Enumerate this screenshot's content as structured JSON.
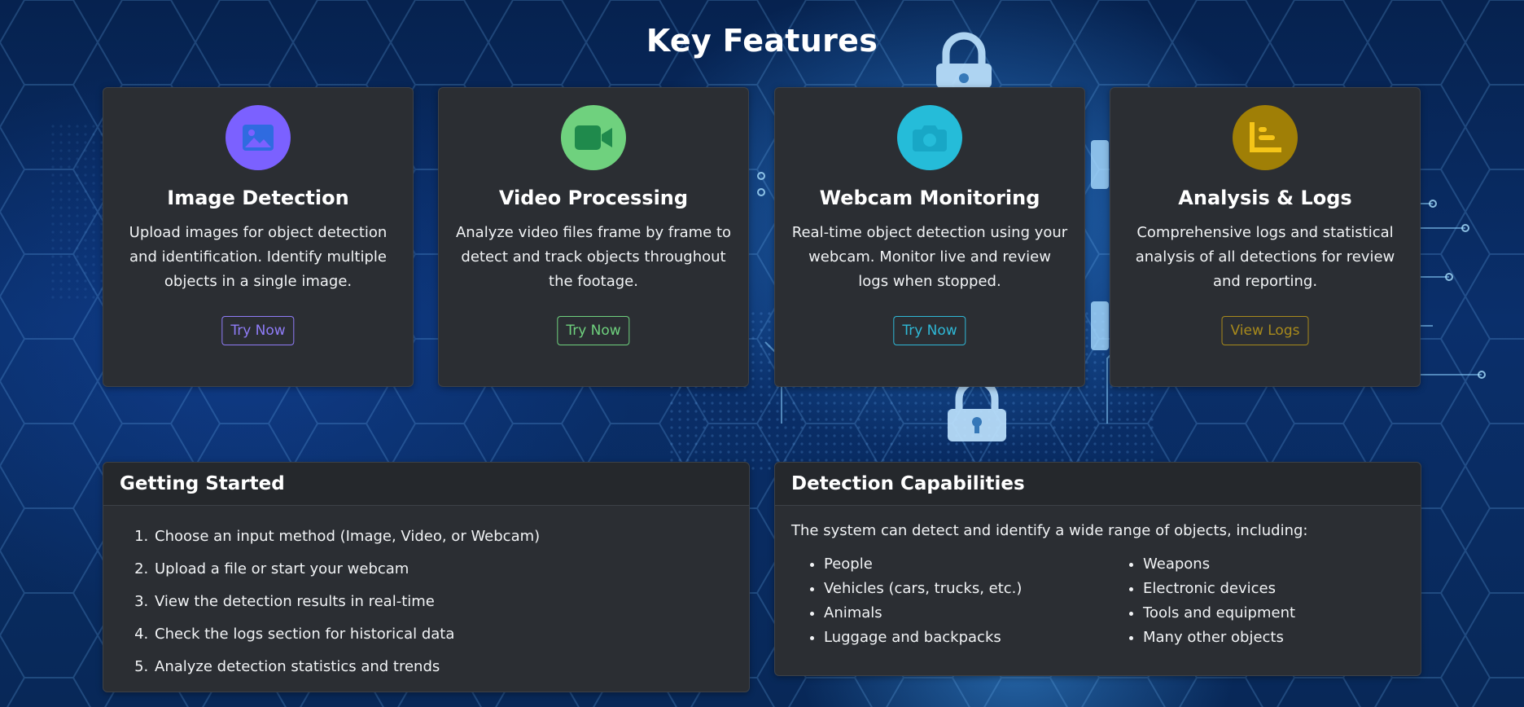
{
  "page": {
    "title": "Key Features"
  },
  "features": [
    {
      "title": "Image Detection",
      "text": "Upload images for object detection and identification. Identify multiple objects in a single image.",
      "button": "Try Now",
      "icon": "image-icon",
      "color": "#7b61ff",
      "button_color": "#8f7cf7"
    },
    {
      "title": "Video Processing",
      "text": "Analyze video files frame by frame to detect and track objects throughout the footage.",
      "button": "Try Now",
      "icon": "video-camera-icon",
      "color": "#6fd17e",
      "button_color": "#6fd17e"
    },
    {
      "title": "Webcam Monitoring",
      "text": "Real-time object detection using your webcam. Monitor live and review logs when stopped.",
      "button": "Try Now",
      "icon": "camera-icon",
      "color": "#25bcd9",
      "button_color": "#2fb8d6"
    },
    {
      "title": "Analysis & Logs",
      "text": "Comprehensive logs and statistical analysis of all detections for review and reporting.",
      "button": "View Logs",
      "icon": "chart-icon",
      "color": "#a07f06",
      "button_color": "#a88a1c"
    }
  ],
  "getting_started": {
    "title": "Getting Started",
    "steps": [
      "Choose an input method (Image, Video, or Webcam)",
      "Upload a file or start your webcam",
      "View the detection results in real-time",
      "Check the logs section for historical data",
      "Analyze detection statistics and trends"
    ]
  },
  "capabilities": {
    "title": "Detection Capabilities",
    "intro": "The system can detect and identify a wide range of objects, including:",
    "left": [
      "People",
      "Vehicles (cars, trucks, etc.)",
      "Animals",
      "Luggage and backpacks"
    ],
    "right": [
      "Weapons",
      "Electronic devices",
      "Tools and equipment",
      "Many other objects"
    ]
  }
}
